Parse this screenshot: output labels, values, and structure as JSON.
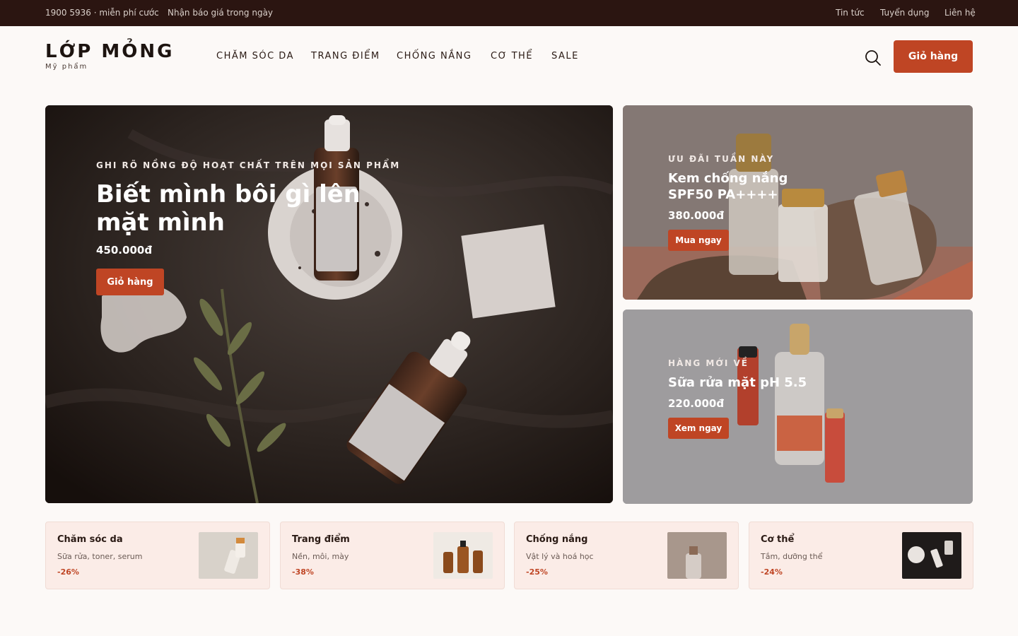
{
  "topbar": {
    "hotline": "1900 5936 · miễn phí cước",
    "promo": "Nhận báo giá trong ngày",
    "links": [
      "Tin tức",
      "Tuyển dụng",
      "Liên hệ"
    ]
  },
  "header": {
    "logo_name": "LỚP MỎNG",
    "logo_sub": "Mỹ phẩm",
    "nav": [
      "CHĂM SÓC DA",
      "TRANG ĐIỂM",
      "CHỐNG NẮNG",
      "CƠ THỂ",
      "SALE"
    ],
    "cart_label": "Giỏ hàng",
    "search_icon": "search-icon"
  },
  "hero": {
    "eyebrow": "GHI RÕ NỒNG ĐỘ HOẠT CHẤT TRÊN MỌI SẢN PHẨM",
    "headline_line1": "Biết mình bôi gì lên",
    "headline_line2": "mặt mình",
    "price": "450.000đ",
    "cta": "Giỏ hàng"
  },
  "promo1": {
    "eyebrow": "ƯU ĐÃI TUẦN NÀY",
    "title_line1": "Kem chống nắng",
    "title_line2": "SPF50 PA++++",
    "price": "380.000đ",
    "cta": "Mua ngay"
  },
  "promo2": {
    "eyebrow": "HÀNG MỚI VỀ",
    "title": "Sữa rửa mặt pH 5.5",
    "price": "220.000đ",
    "cta": "Xem ngay"
  },
  "categories": [
    {
      "title": "Chăm sóc da",
      "desc": "Sữa rửa, toner, serum",
      "discount": "-26%"
    },
    {
      "title": "Trang điểm",
      "desc": "Nền, môi, mày",
      "discount": "-38%"
    },
    {
      "title": "Chống nắng",
      "desc": "Vật lý và hoá học",
      "discount": "-25%"
    },
    {
      "title": "Cơ thể",
      "desc": "Tắm, dưỡng thể",
      "discount": "-24%"
    }
  ],
  "colors": {
    "accent": "#bf4524",
    "topbar": "#2b1511",
    "page_bg": "#fcf9f7",
    "card_bg": "#fbece7"
  }
}
